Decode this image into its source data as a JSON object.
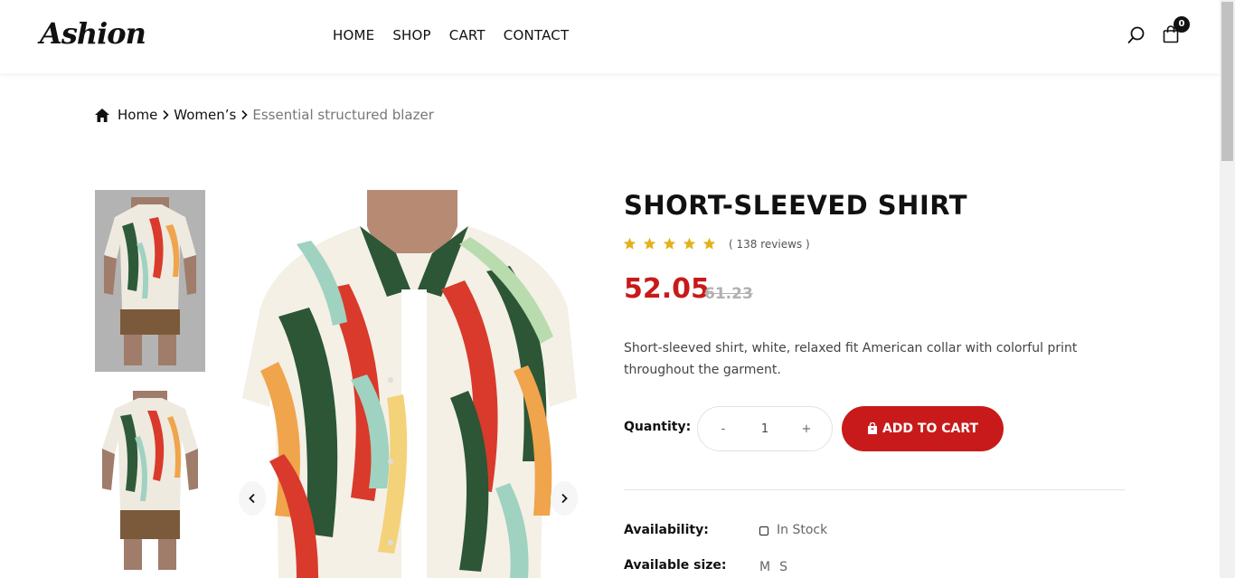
{
  "header": {
    "logo": "Ashion",
    "nav": [
      "HOME",
      "SHOP",
      "CART",
      "CONTACT"
    ],
    "cart_count": "0",
    "icons": {
      "search": "search-icon",
      "cart": "shopping-bag-icon"
    }
  },
  "breadcrumb": {
    "items": [
      "Home",
      "Women’s"
    ],
    "current": "Essential structured blazer"
  },
  "product": {
    "title": "SHORT-SLEEVED SHIRT",
    "rating_stars": 5,
    "reviews": "( 138 reviews )",
    "price": "52.05",
    "old_price": "61.23",
    "description": "Short-sleeved shirt, white, relaxed fit American collar with colorful print throughout the garment.",
    "quantity_label": "Quantity:",
    "quantity_minus": "-",
    "quantity_value": "1",
    "quantity_plus": "+",
    "add_to_cart": "ADD TO CART",
    "availability_label": "Availability:",
    "availability_value": "In Stock",
    "size_label": "Available size:",
    "sizes": [
      "M",
      "S"
    ]
  },
  "colors": {
    "accent": "#c81a1a",
    "star": "#e3b21b",
    "text": "#111111"
  }
}
